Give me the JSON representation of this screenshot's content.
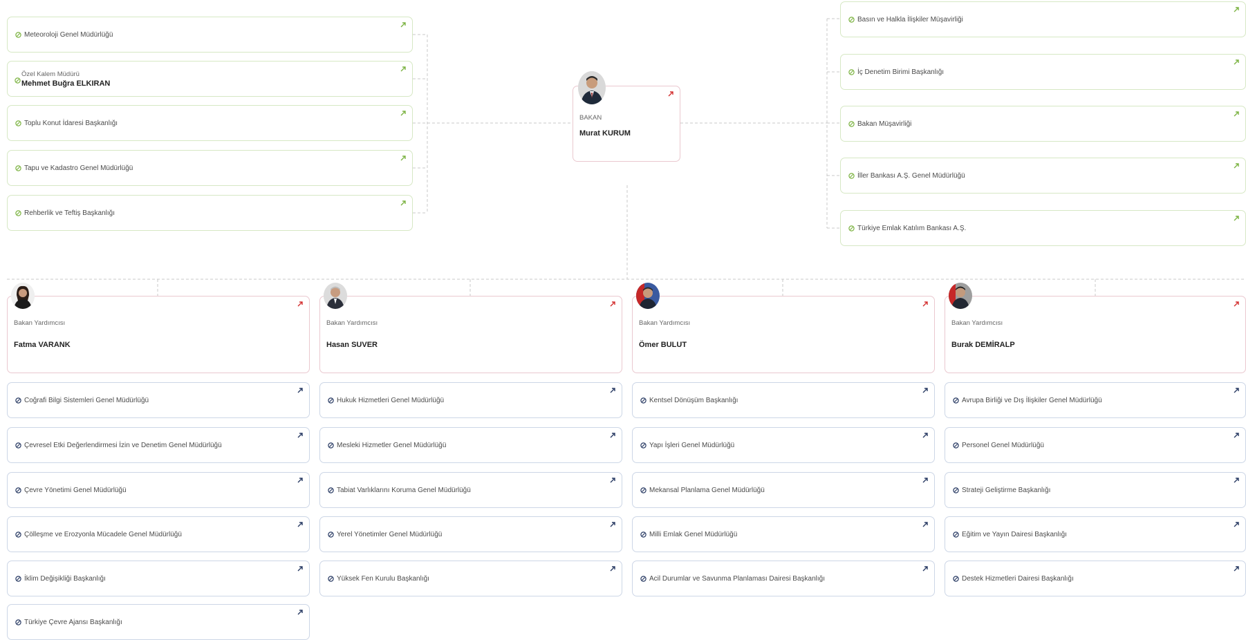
{
  "colors": {
    "green_arrow": "#7cb342",
    "red_arrow": "#d32f2f",
    "navy_arrow": "#283a63",
    "green_border": "#d6e8c4",
    "blue_border": "#ccd6e6",
    "pink_border": "#eac8cf"
  },
  "minister": {
    "role": "BAKAN",
    "name": "Murat KURUM"
  },
  "left_units": [
    {
      "label": "Meteoroloji Genel Müdürlüğü"
    },
    {
      "sub": "Özel Kalem Müdürü",
      "name": "Mehmet Buğra ELKIRAN"
    },
    {
      "label": "Toplu Konut İdaresi Başkanlığı"
    },
    {
      "label": "Tapu ve Kadastro Genel Müdürlüğü"
    },
    {
      "label": "Rehberlik ve Teftiş Başkanlığı"
    }
  ],
  "right_units": [
    {
      "label": "Basın ve Halkla İlişkiler Müşavirliği"
    },
    {
      "label": "İç Denetim Birimi Başkanlığı"
    },
    {
      "label": "Bakan Müşavirliği"
    },
    {
      "label": "İller Bankası A.Ş. Genel Müdürlüğü"
    },
    {
      "label": "Türkiye Emlak Katılım Bankası A.Ş."
    }
  ],
  "deputies": [
    {
      "role": "Bakan Yardımcısı",
      "name": "Fatma VARANK",
      "units": [
        "Coğrafi Bilgi Sistemleri Genel Müdürlüğü",
        "Çevresel Etki Değerlendirmesi İzin ve Denetim Genel Müdürlüğü",
        "Çevre Yönetimi Genel Müdürlüğü",
        "Çölleşme ve Erozyonla Mücadele Genel Müdürlüğü",
        "İklim Değişikliği Başkanlığı",
        "Türkiye Çevre Ajansı Başkanlığı"
      ]
    },
    {
      "role": "Bakan Yardımcısı",
      "name": "Hasan SUVER",
      "units": [
        "Hukuk Hizmetleri Genel Müdürlüğü",
        "Mesleki Hizmetler Genel Müdürlüğü",
        "Tabiat Varlıklarını Koruma Genel Müdürlüğü",
        "Yerel Yönetimler Genel Müdürlüğü",
        "Yüksek Fen Kurulu Başkanlığı"
      ]
    },
    {
      "role": "Bakan Yardımcısı",
      "name": "Ömer BULUT",
      "units": [
        "Kentsel Dönüşüm Başkanlığı",
        "Yapı İşleri Genel Müdürlüğü",
        "Mekansal Planlama Genel Müdürlüğü",
        "Milli Emlak Genel Müdürlüğü",
        "Acil Durumlar ve Savunma Planlaması Dairesi Başkanlığı"
      ]
    },
    {
      "role": "Bakan Yardımcısı",
      "name": "Burak DEMİRALP",
      "units": [
        "Avrupa Birliği ve Dış İlişkiler Genel Müdürlüğü",
        "Personel Genel Müdürlüğü",
        "Strateji Geliştirme Başkanlığı",
        "Eğitim ve Yayın Dairesi Başkanlığı",
        "Destek Hizmetleri Dairesi Başkanlığı"
      ]
    }
  ]
}
